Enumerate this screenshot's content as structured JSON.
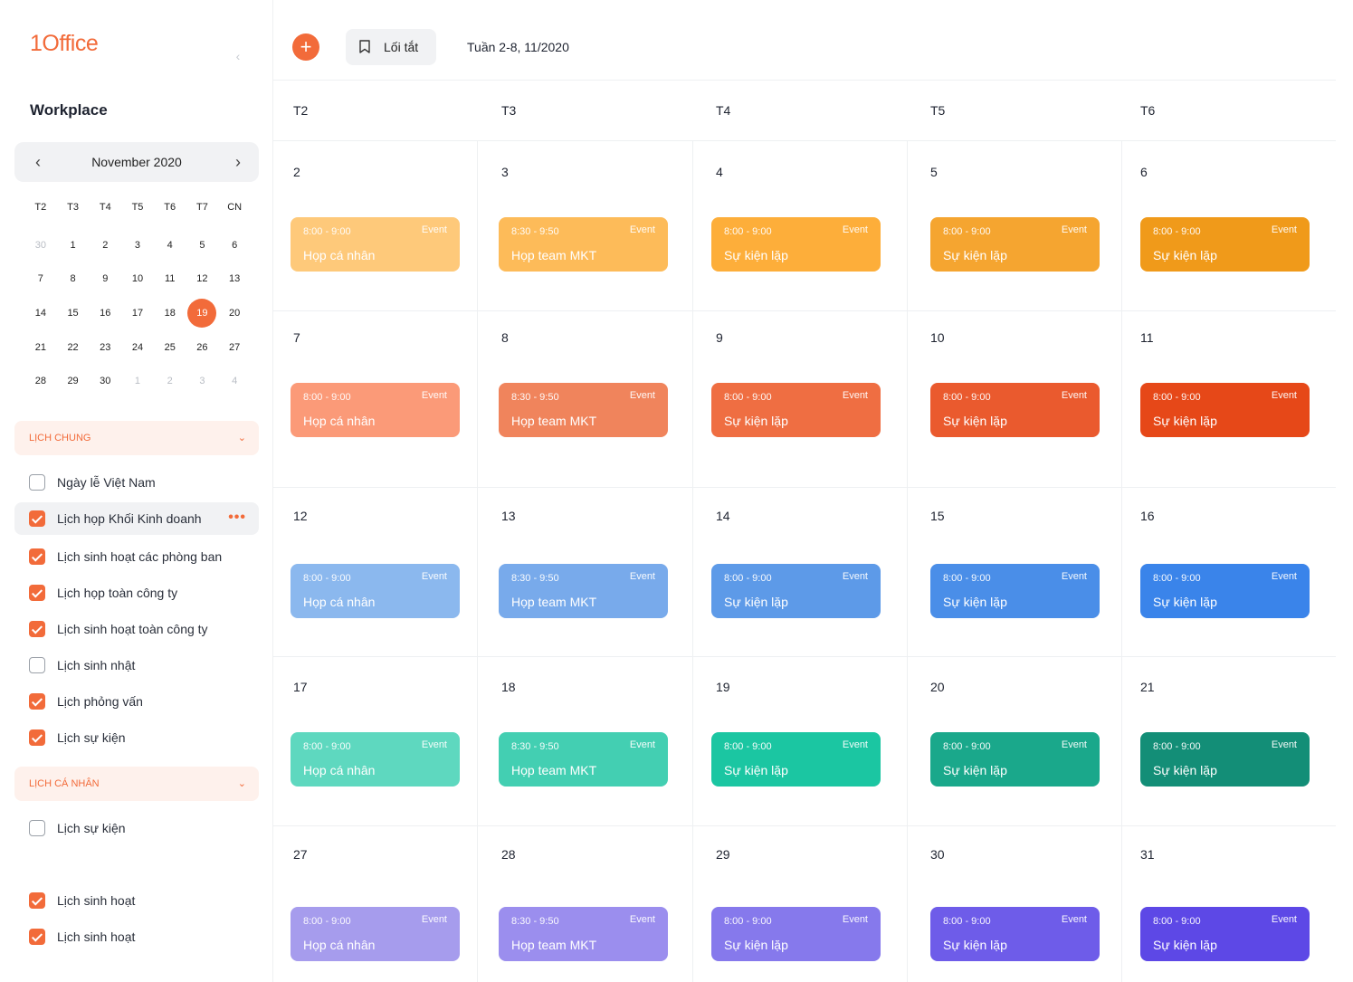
{
  "app": {
    "logo": "1Office",
    "collapse_icon": "chevron-left-icon"
  },
  "sidebar": {
    "title": "Workplace",
    "mini_calendar": {
      "month_label": "November 2020",
      "weekdays": [
        "T2",
        "T3",
        "T4",
        "T5",
        "T6",
        "T7",
        "CN"
      ],
      "selected_day": "19",
      "days": [
        {
          "d": "30",
          "m": true
        },
        {
          "d": "1"
        },
        {
          "d": "2"
        },
        {
          "d": "3"
        },
        {
          "d": "4"
        },
        {
          "d": "5"
        },
        {
          "d": "6"
        },
        {
          "d": "7"
        },
        {
          "d": "8"
        },
        {
          "d": "9"
        },
        {
          "d": "10"
        },
        {
          "d": "11"
        },
        {
          "d": "12"
        },
        {
          "d": "13"
        },
        {
          "d": "14"
        },
        {
          "d": "15"
        },
        {
          "d": "16"
        },
        {
          "d": "17"
        },
        {
          "d": "18"
        },
        {
          "d": "19",
          "s": true
        },
        {
          "d": "20"
        },
        {
          "d": "21"
        },
        {
          "d": "22"
        },
        {
          "d": "23"
        },
        {
          "d": "24"
        },
        {
          "d": "25"
        },
        {
          "d": "26"
        },
        {
          "d": "27"
        },
        {
          "d": "28"
        },
        {
          "d": "29"
        },
        {
          "d": "30"
        },
        {
          "d": "1",
          "m": true
        },
        {
          "d": "2",
          "m": true
        },
        {
          "d": "3",
          "m": true
        },
        {
          "d": "4",
          "m": true
        }
      ]
    },
    "sections": [
      {
        "label": "LỊCH CHUNG",
        "items": [
          {
            "name": "Ngày lễ Việt Nam",
            "checked": false
          },
          {
            "name": "Lịch họp Khối Kinh doanh",
            "checked": true,
            "active": true,
            "more": "•••"
          },
          {
            "name": "Lịch sinh hoạt các phòng ban",
            "checked": true
          },
          {
            "name": "Lịch họp toàn công ty",
            "checked": true
          },
          {
            "name": "Lịch sinh hoạt toàn công ty",
            "checked": true
          },
          {
            "name": "Lịch sinh nhật",
            "checked": false
          },
          {
            "name": "Lịch phỏng vấn",
            "checked": true
          },
          {
            "name": "Lịch sự kiện",
            "checked": true
          }
        ]
      },
      {
        "label": "LỊCH CÁ NHÂN",
        "items": [
          {
            "name": "Lịch sự kiện",
            "checked": false
          },
          {
            "name": "Lịch sinh hoạt",
            "checked": true
          },
          {
            "name": "Lịch sinh hoạt",
            "checked": true
          }
        ]
      }
    ]
  },
  "toolbar": {
    "add_icon": "plus-icon",
    "shortcut_label": "Lối tắt",
    "shortcut_icon": "bookmark-icon",
    "week_label": "Tuần 2-8, 11/2020"
  },
  "calendar": {
    "weekdays": [
      "T2",
      "T3",
      "T4",
      "T5",
      "T6"
    ],
    "event_tag": "Event",
    "weeks": [
      {
        "days": [
          "2",
          "3",
          "4",
          "5",
          "6"
        ],
        "colors": [
          "#fec97a",
          "#fdbb59",
          "#fdae3a",
          "#f5a530",
          "#f09a1a"
        ]
      },
      {
        "days": [
          "7",
          "8",
          "9",
          "10",
          "11"
        ],
        "colors": [
          "#fb9a78",
          "#f0845c",
          "#ef6e42",
          "#ea5a2e",
          "#e64818"
        ]
      },
      {
        "days": [
          "12",
          "13",
          "14",
          "15",
          "16"
        ],
        "colors": [
          "#8bb8ee",
          "#78aaeb",
          "#5d9ae8",
          "#4a8ee8",
          "#3a84ea"
        ]
      },
      {
        "days": [
          "17",
          "18",
          "19",
          "20",
          "21"
        ],
        "colors": [
          "#5ed8bf",
          "#43cfb2",
          "#1bc6a2",
          "#1aa88b",
          "#138e77"
        ]
      },
      {
        "days": [
          "27",
          "28",
          "29",
          "30",
          "31"
        ],
        "colors": [
          "#a69ced",
          "#9b8eee",
          "#8679ec",
          "#6e5ce9",
          "#5d48e6"
        ]
      }
    ],
    "events_by_col": [
      {
        "time": "8:00 - 9:00",
        "title": "Họp cá nhân"
      },
      {
        "time": "8:30 - 9:50",
        "title": "Họp team MKT"
      },
      {
        "time": "8:00 - 9:00",
        "title": "Sự kiện lặp"
      },
      {
        "time": "8:00 - 9:00",
        "title": "Sự kiện lặp"
      },
      {
        "time": "8:00 - 9:00",
        "title": "Sự kiện lặp"
      }
    ]
  }
}
